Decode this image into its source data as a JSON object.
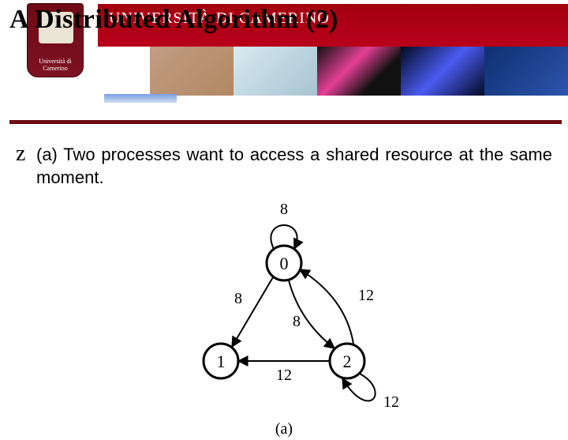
{
  "university_name": "UNIVERSITÀ DI CAMERINO",
  "crest_label": "Università di Camerino",
  "slide_title": "A Distributed Algorithm (2)",
  "bullet_marker": "z",
  "bullet_text": "(a) Two processes want to access a shared resource at the same moment.",
  "caption": "(a)",
  "diagram": {
    "nodes": [
      {
        "id": "0",
        "label": "0"
      },
      {
        "id": "1",
        "label": "1"
      },
      {
        "id": "2",
        "label": "2"
      }
    ],
    "edges": [
      {
        "from": "0",
        "to": "0",
        "label": "8",
        "kind": "self"
      },
      {
        "from": "0",
        "to": "1",
        "label": "8"
      },
      {
        "from": "0",
        "to": "2",
        "label": "8"
      },
      {
        "from": "2",
        "to": "0",
        "label": "12"
      },
      {
        "from": "2",
        "to": "1",
        "label": "12"
      },
      {
        "from": "2",
        "to": "2",
        "label": "12",
        "kind": "self"
      }
    ]
  }
}
